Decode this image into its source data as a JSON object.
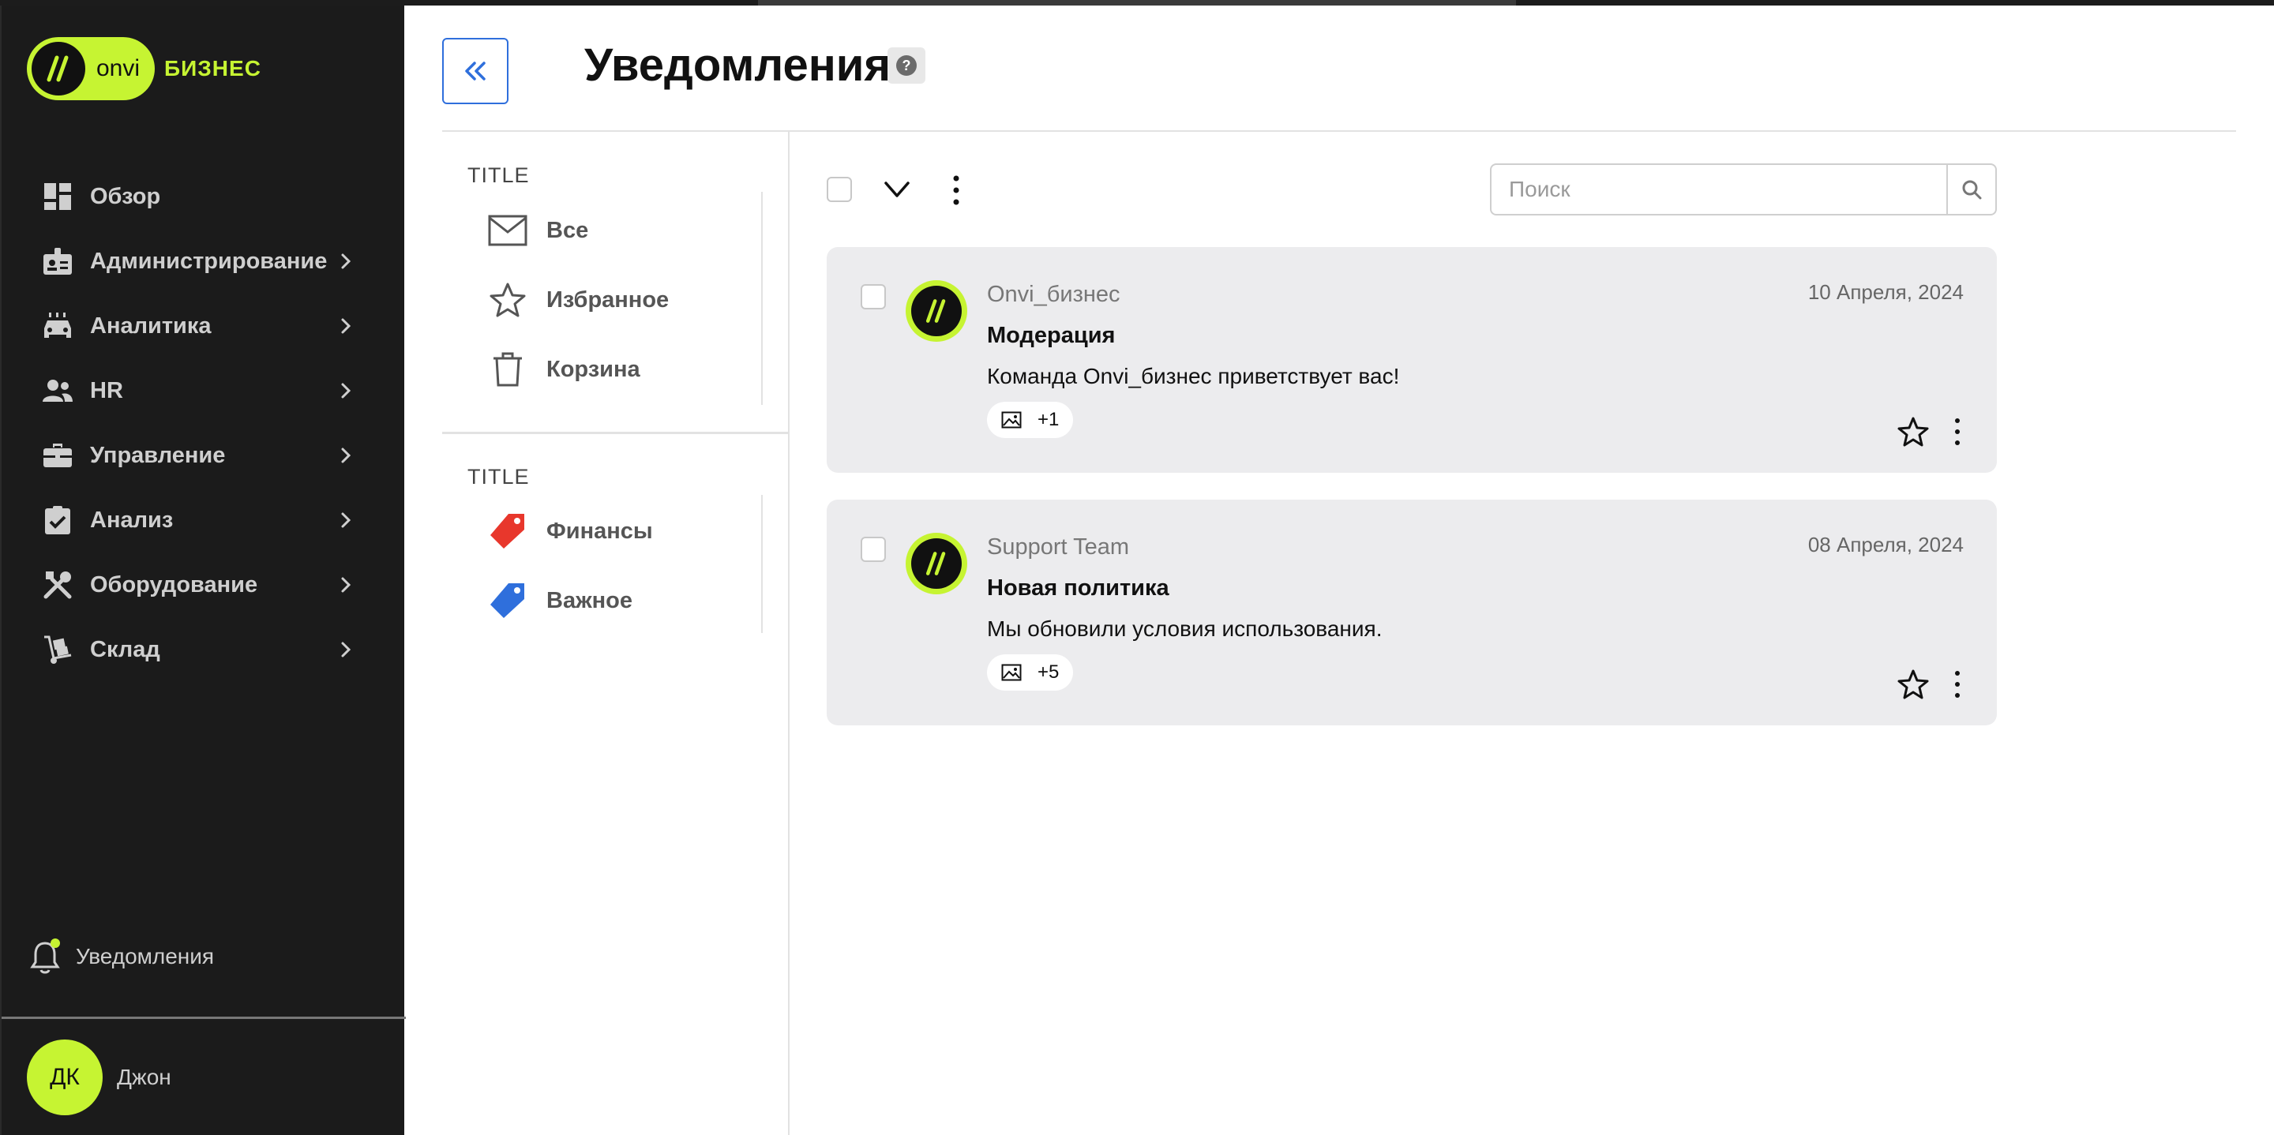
{
  "brand": {
    "logo_text": "onvi",
    "logo_suffix": "БИЗНЕС",
    "accent": "#c6f432"
  },
  "sidebar": {
    "items": [
      {
        "label": "Обзор",
        "icon": "dashboard-icon",
        "has_submenu": false
      },
      {
        "label": "Администрирование",
        "icon": "admin-badge-icon",
        "has_submenu": true
      },
      {
        "label": "Аналитика",
        "icon": "car-icon",
        "has_submenu": true
      },
      {
        "label": "HR",
        "icon": "people-icon",
        "has_submenu": true
      },
      {
        "label": "Управление",
        "icon": "briefcase-icon",
        "has_submenu": true
      },
      {
        "label": "Анализ",
        "icon": "clipboard-check-icon",
        "has_submenu": true
      },
      {
        "label": "Оборудование",
        "icon": "tools-icon",
        "has_submenu": true
      },
      {
        "label": "Склад",
        "icon": "hand-truck-icon",
        "has_submenu": true
      }
    ],
    "notifications_label": "Уведомления",
    "user": {
      "initials": "ДК",
      "name": "Джон"
    }
  },
  "header": {
    "title": "Уведомления",
    "help_symbol": "?"
  },
  "folders": {
    "sections": [
      {
        "title": "TITLE",
        "items": [
          {
            "label": "Все",
            "icon": "mail-icon"
          },
          {
            "label": "Избранное",
            "icon": "star-icon"
          },
          {
            "label": "Корзина",
            "icon": "trash-icon"
          }
        ]
      },
      {
        "title": "TITLE",
        "items": [
          {
            "label": "Финансы",
            "icon": "tag-icon",
            "color": "#e8372c"
          },
          {
            "label": "Важное",
            "icon": "tag-icon",
            "color": "#2f6fdc"
          }
        ]
      }
    ]
  },
  "search": {
    "placeholder": "Поиск",
    "value": ""
  },
  "messages": [
    {
      "sender": "Onvi_бизнес",
      "date": "10 Апреля, 2024",
      "subject": "Модерация",
      "body": "Команда Onvi_бизнес приветствует вас!",
      "attachments": "+1"
    },
    {
      "sender": "Support Team",
      "date": "08 Апреля, 2024",
      "subject": "Новая политика",
      "body": "Мы обновили условия использования.",
      "attachments": "+5"
    }
  ]
}
